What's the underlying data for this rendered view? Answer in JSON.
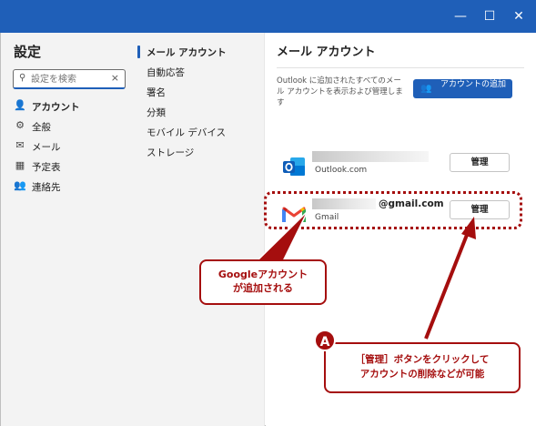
{
  "window": {
    "controls": {
      "minimize": "—",
      "maximize": "☐",
      "close": "✕"
    }
  },
  "nav": {
    "title": "設定",
    "search": {
      "placeholder": "設定を検索",
      "clear": "×"
    },
    "items": [
      {
        "label": "アカウント",
        "icon": "person-icon",
        "glyph": "👤",
        "active": true
      },
      {
        "label": "全般",
        "icon": "gear-icon",
        "glyph": "⚙",
        "active": false
      },
      {
        "label": "メール",
        "icon": "mail-icon",
        "glyph": "✉",
        "active": false
      },
      {
        "label": "予定表",
        "icon": "calendar-icon",
        "glyph": "▦",
        "active": false
      },
      {
        "label": "連絡先",
        "icon": "people-icon",
        "glyph": "👥",
        "active": false
      }
    ]
  },
  "subnav": {
    "items": [
      {
        "label": "メール アカウント",
        "active": true
      },
      {
        "label": "自動応答"
      },
      {
        "label": "署名"
      },
      {
        "label": "分類"
      },
      {
        "label": "モバイル デバイス"
      },
      {
        "label": "ストレージ"
      }
    ]
  },
  "main": {
    "title": "メール アカウント",
    "description": "Outlook に追加されたすべてのメール アカウントを表示および管理します",
    "add_button": {
      "label": "アカウントの追加",
      "icon": "add-person-icon"
    },
    "accounts": [
      {
        "provider": "Outlook.com",
        "email_visible": "",
        "manage": "管理",
        "logo": "outlook-logo-icon"
      },
      {
        "provider": "Gmail",
        "email_visible": "@gmail.com",
        "manage": "管理",
        "logo": "gmail-logo-icon"
      }
    ]
  },
  "annotations": {
    "callout_google": {
      "line1": "Googleアカウント",
      "line2": "が追加される"
    },
    "callout_manage": {
      "badge": "A",
      "line1": "［管理］ボタンをクリックして",
      "line2": "アカウントの削除などが可能"
    }
  },
  "colors": {
    "titlebar": "#1f5fb8",
    "accent": "#1f5fb8",
    "annotation": "#a50e0e",
    "sidebar_bg": "#f3f3f3"
  }
}
